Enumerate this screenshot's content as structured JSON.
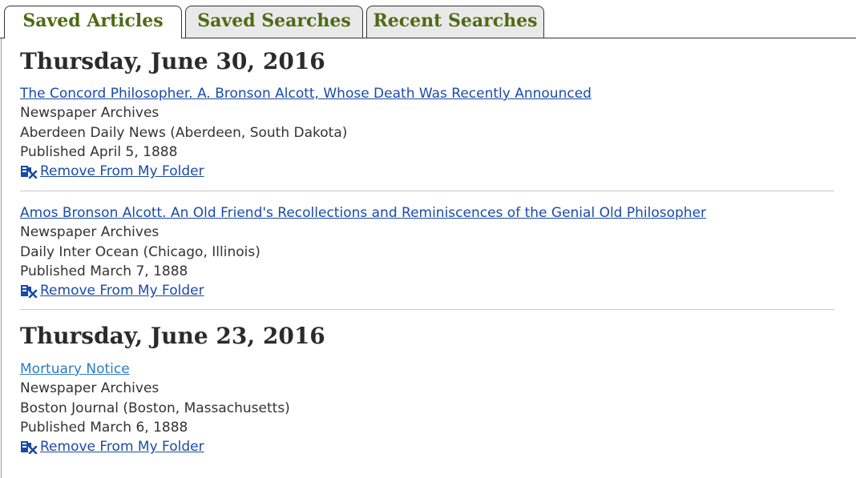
{
  "tabs": [
    {
      "label": "Saved Articles",
      "active": true
    },
    {
      "label": "Saved Searches",
      "active": false
    },
    {
      "label": "Recent Searches",
      "active": false
    }
  ],
  "groups": [
    {
      "date": "Thursday, June 30, 2016",
      "articles": [
        {
          "title": "The Concord Philosopher. A. Bronson Alcott, Whose Death Was Recently Announced",
          "collection": "Newspaper Archives",
          "source": "Aberdeen Daily News (Aberdeen, South Dakota)",
          "published": "Published April 5, 1888",
          "remove_label": "Remove From My Folder"
        },
        {
          "title": "Amos Bronson Alcott. An Old Friend's Recollections and Reminiscences of the Genial Old Philosopher",
          "collection": "Newspaper Archives",
          "source": "Daily Inter Ocean (Chicago, Illinois)",
          "published": "Published March 7, 1888",
          "remove_label": "Remove From My Folder"
        }
      ]
    },
    {
      "date": "Thursday, June 23, 2016",
      "articles": [
        {
          "title": "Mortuary Notice",
          "collection": "Newspaper Archives",
          "source": "Boston Journal (Boston, Massachusetts)",
          "published": "Published March 6, 1888",
          "remove_label": "Remove From My Folder"
        }
      ]
    }
  ],
  "icons": {
    "remove": "folder-remove-icon"
  },
  "colors": {
    "tab_text": "#4d6b12",
    "link": "#1a4ba8",
    "link_light": "#2a7dc0",
    "heading": "#2b2b2b",
    "body_text": "#333333"
  }
}
